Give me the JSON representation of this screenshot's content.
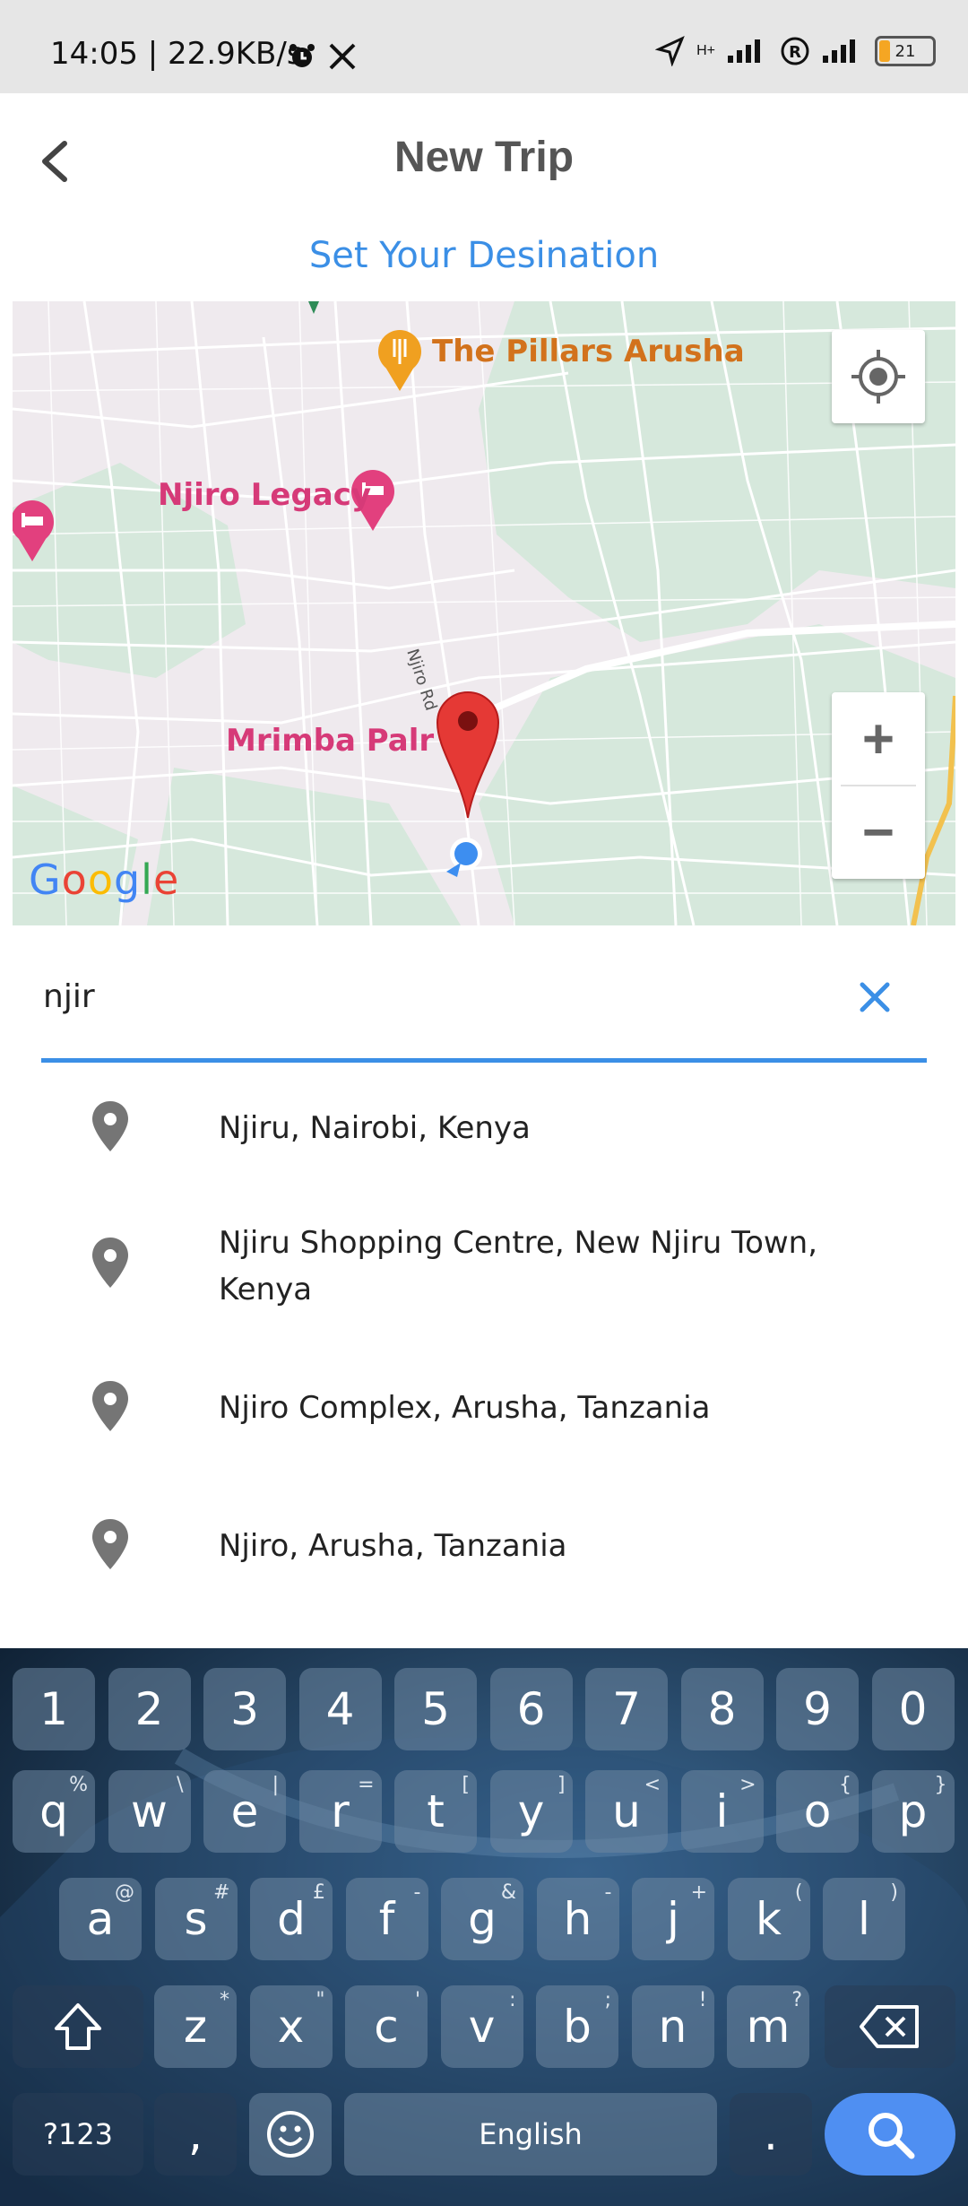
{
  "status_bar": {
    "time_speed": "14:05 | 22.9KB/s",
    "battery": "21",
    "network": "H+"
  },
  "header": {
    "title": "New Trip"
  },
  "subtitle": "Set Your Desination",
  "map": {
    "pois": [
      {
        "name": "The Pillars Arusha",
        "color": "#d2721c"
      },
      {
        "name": "Njiro Legacy",
        "color": "#d63a78"
      },
      {
        "name": "Mrimba Palr",
        "color": "#d63a78"
      }
    ],
    "road_label": "Njiro Rd",
    "google_letters": [
      "G",
      "o",
      "o",
      "g",
      "l",
      "e"
    ],
    "zoom_in": "+",
    "zoom_out": "−"
  },
  "search": {
    "value": "njir",
    "placeholder": ""
  },
  "results": [
    {
      "line1": "Njiru, Nairobi, Kenya",
      "line2": ""
    },
    {
      "line1": "Njiru Shopping Centre, New Njiru Town,",
      "line2": "Kenya"
    },
    {
      "line1": "Njiro Complex, Arusha, Tanzania",
      "line2": ""
    },
    {
      "line1": "Njiro, Arusha, Tanzania",
      "line2": ""
    }
  ],
  "keyboard": {
    "row_numbers": [
      "1",
      "2",
      "3",
      "4",
      "5",
      "6",
      "7",
      "8",
      "9",
      "0"
    ],
    "row_q": [
      [
        "q",
        "%"
      ],
      [
        "w",
        "\\"
      ],
      [
        "e",
        "|"
      ],
      [
        "r",
        "="
      ],
      [
        "t",
        "["
      ],
      [
        "y",
        "]"
      ],
      [
        "u",
        "<"
      ],
      [
        "i",
        ">"
      ],
      [
        "o",
        "{"
      ],
      [
        "p",
        "}"
      ]
    ],
    "row_a": [
      [
        "a",
        "@"
      ],
      [
        "s",
        "#"
      ],
      [
        "d",
        "£"
      ],
      [
        "f",
        "-"
      ],
      [
        "g",
        "&"
      ],
      [
        "h",
        "-"
      ],
      [
        "j",
        "+"
      ],
      [
        "k",
        "("
      ],
      [
        "l",
        ")"
      ]
    ],
    "row_z": [
      [
        "z",
        "*"
      ],
      [
        "x",
        "\""
      ],
      [
        "c",
        "'"
      ],
      [
        "v",
        ":"
      ],
      [
        "b",
        ";"
      ],
      [
        "n",
        "!"
      ],
      [
        "m",
        "?"
      ]
    ],
    "symbols_key": "?123",
    "comma_key": ",",
    "space_key": "English",
    "period_key": "."
  },
  "colors": {
    "accent": "#3b8fe6",
    "pin_red": "#e53935",
    "pin_grey": "#757575"
  }
}
